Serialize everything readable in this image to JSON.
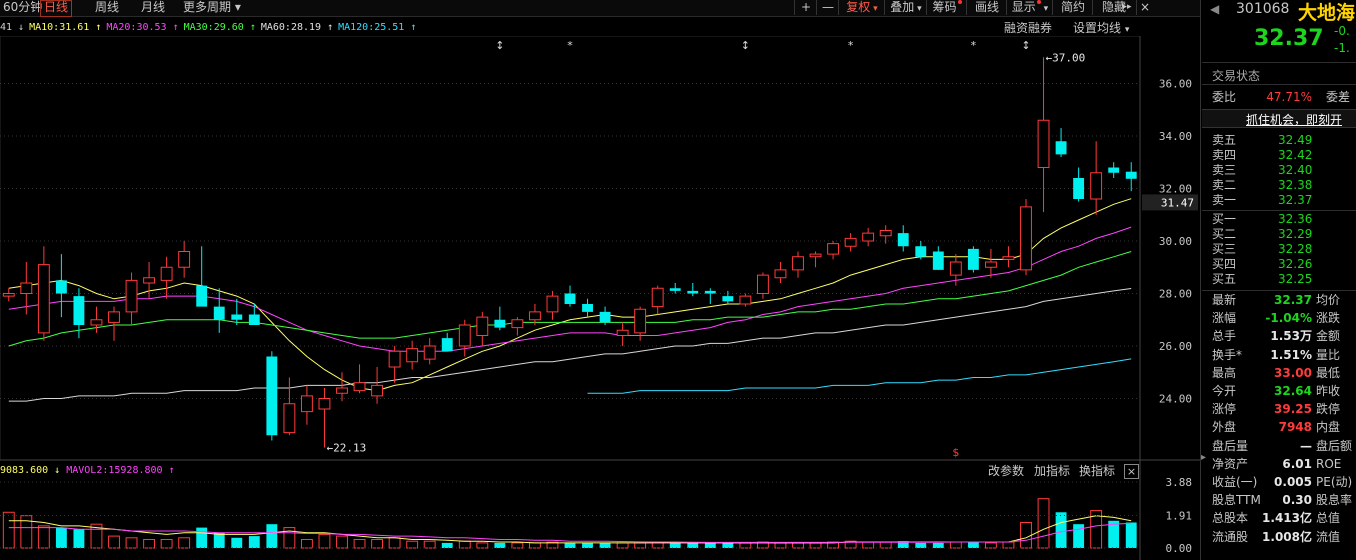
{
  "toolbar": {
    "left_tabs": [
      "60分钟",
      "日线",
      "周线",
      "月线",
      "更多周期"
    ],
    "active_tab": "日线",
    "right_buttons": [
      {
        "label": "+",
        "red": false,
        "dot": false,
        "arrow": false
      },
      {
        "label": "—",
        "red": false,
        "dot": false,
        "arrow": false
      },
      {
        "label": "复权",
        "red": true,
        "dot": false,
        "arrow": true
      },
      {
        "label": "叠加",
        "red": false,
        "dot": false,
        "arrow": true
      },
      {
        "label": "筹码",
        "red": false,
        "dot": true,
        "arrow": false
      },
      {
        "label": "画线",
        "red": false,
        "dot": false,
        "arrow": false
      },
      {
        "label": "显示",
        "red": false,
        "dot": true,
        "arrow": true
      },
      {
        "label": "简约",
        "red": false,
        "dot": false,
        "arrow": false
      },
      {
        "label": "隐藏",
        "red": false,
        "dot": false,
        "arrow": false
      }
    ]
  },
  "ma_legend": [
    {
      "text": "41 ↓",
      "color": "#d0d0d0"
    },
    {
      "text": "MA10:31.61 ↑",
      "color": "#ffff66"
    },
    {
      "text": "MA20:30.53 ↑",
      "color": "#ff44ff"
    },
    {
      "text": "MA30:29.60 ↑",
      "color": "#44ff44"
    },
    {
      "text": "MA60:28.19 ↑",
      "color": "#e0e0e0"
    },
    {
      "text": "MA120:25.51 ↑",
      "color": "#33ddff"
    }
  ],
  "top_right": {
    "financing": "融资融券",
    "ma_settings": "设置均线"
  },
  "annotations": {
    "high": "37.00",
    "low": "22.13",
    "current_price_tag": "31.47"
  },
  "event_markers": [
    "↕",
    "*",
    "↕",
    "*",
    "*",
    "↕"
  ],
  "volume_legend": [
    {
      "text": "9083.600 ↓",
      "color": "#ffff66"
    },
    {
      "text": "MAVOL2:15928.800 ↑",
      "color": "#ff44ff"
    }
  ],
  "volume_tools": {
    "param": "改参数",
    "add": "加指标",
    "swap": "换指标",
    "close": "×"
  },
  "chart_data": {
    "type": "candlestick",
    "price_axis": {
      "min": 22,
      "max": 38,
      "ticks": [
        "36.00",
        "34.00",
        "32.00",
        "30.00",
        "28.00",
        "26.00",
        "24.00"
      ]
    },
    "volume_axis": {
      "ticks": [
        "3.88",
        "1.91",
        "0.00"
      ]
    },
    "candles": [
      [
        27.9,
        28.2,
        27.7,
        28.0
      ],
      [
        28.0,
        29.2,
        27.2,
        28.4
      ],
      [
        26.5,
        29.8,
        26.2,
        29.1
      ],
      [
        28.5,
        29.5,
        27.1,
        28.0
      ],
      [
        27.9,
        28.2,
        26.3,
        26.8
      ],
      [
        26.8,
        27.5,
        26.5,
        27.0
      ],
      [
        26.9,
        27.5,
        26.2,
        27.3
      ],
      [
        27.3,
        28.8,
        26.8,
        28.5
      ],
      [
        28.4,
        29.2,
        27.8,
        28.6
      ],
      [
        28.5,
        29.4,
        27.8,
        29.0
      ],
      [
        29.0,
        30.0,
        28.6,
        29.6
      ],
      [
        28.3,
        29.8,
        27.6,
        27.5
      ],
      [
        27.5,
        28.2,
        26.5,
        27.0
      ],
      [
        27.2,
        27.8,
        26.8,
        27.0
      ],
      [
        27.2,
        27.6,
        26.8,
        26.8
      ],
      [
        25.6,
        25.8,
        22.4,
        22.6
      ],
      [
        22.7,
        24.8,
        22.6,
        23.8
      ],
      [
        23.5,
        24.5,
        23.0,
        24.1
      ],
      [
        23.6,
        24.4,
        22.13,
        24.0
      ],
      [
        24.2,
        25.0,
        23.9,
        24.4
      ],
      [
        24.3,
        25.3,
        24.2,
        24.6
      ],
      [
        24.1,
        25.2,
        23.8,
        24.5
      ],
      [
        25.2,
        26.0,
        24.6,
        25.8
      ],
      [
        25.4,
        26.2,
        25.1,
        25.9
      ],
      [
        25.5,
        26.3,
        25.3,
        26.0
      ],
      [
        26.3,
        26.5,
        25.8,
        25.8
      ],
      [
        26.0,
        27.0,
        25.6,
        26.8
      ],
      [
        26.4,
        27.3,
        26.0,
        27.1
      ],
      [
        27.0,
        27.5,
        26.6,
        26.7
      ],
      [
        26.7,
        27.1,
        26.4,
        27.0
      ],
      [
        27.0,
        27.6,
        26.8,
        27.3
      ],
      [
        27.3,
        28.1,
        27.0,
        27.9
      ],
      [
        28.0,
        28.3,
        27.5,
        27.6
      ],
      [
        27.6,
        27.8,
        27.1,
        27.3
      ],
      [
        27.3,
        27.5,
        26.8,
        26.9
      ],
      [
        26.4,
        26.9,
        26.0,
        26.6
      ],
      [
        26.5,
        27.5,
        26.2,
        27.4
      ],
      [
        27.5,
        28.3,
        27.2,
        28.2
      ],
      [
        28.2,
        28.4,
        28.0,
        28.1
      ],
      [
        28.1,
        28.4,
        27.9,
        28.0
      ],
      [
        28.1,
        28.2,
        27.6,
        28.0
      ],
      [
        27.9,
        28.1,
        27.6,
        27.7
      ],
      [
        27.6,
        28.0,
        27.5,
        27.9
      ],
      [
        28.0,
        28.8,
        27.8,
        28.7
      ],
      [
        28.6,
        29.2,
        28.4,
        28.9
      ],
      [
        28.9,
        29.6,
        28.6,
        29.4
      ],
      [
        29.4,
        29.6,
        29.0,
        29.5
      ],
      [
        29.5,
        30.0,
        29.3,
        29.9
      ],
      [
        29.8,
        30.3,
        29.6,
        30.1
      ],
      [
        30.0,
        30.5,
        29.8,
        30.3
      ],
      [
        30.2,
        30.6,
        29.9,
        30.4
      ],
      [
        30.3,
        30.6,
        29.6,
        29.8
      ],
      [
        29.8,
        30.0,
        29.3,
        29.4
      ],
      [
        29.6,
        29.8,
        28.9,
        28.9
      ],
      [
        28.7,
        29.5,
        28.3,
        29.2
      ],
      [
        29.7,
        29.8,
        28.8,
        28.9
      ],
      [
        29.0,
        29.7,
        28.6,
        29.2
      ],
      [
        29.3,
        29.8,
        29.0,
        29.4
      ],
      [
        28.9,
        31.6,
        28.7,
        31.3
      ],
      [
        32.8,
        37.0,
        31.1,
        34.6
      ],
      [
        33.8,
        34.3,
        33.2,
        33.3
      ],
      [
        32.4,
        32.8,
        31.5,
        31.6
      ],
      [
        31.6,
        33.8,
        31.0,
        32.6
      ],
      [
        32.8,
        33.0,
        32.4,
        32.6
      ],
      [
        32.64,
        33.0,
        31.9,
        32.37
      ]
    ],
    "volumes": [
      2.1,
      1.9,
      1.3,
      1.2,
      1.1,
      1.4,
      0.7,
      0.6,
      0.5,
      0.5,
      0.6,
      1.2,
      0.9,
      0.6,
      0.7,
      1.4,
      1.2,
      0.5,
      0.8,
      0.7,
      0.5,
      0.5,
      0.6,
      0.4,
      0.4,
      0.3,
      0.4,
      0.3,
      0.3,
      0.3,
      0.3,
      0.35,
      0.3,
      0.3,
      0.3,
      0.3,
      0.3,
      0.35,
      0.3,
      0.3,
      0.3,
      0.3,
      0.3,
      0.35,
      0.3,
      0.3,
      0.3,
      0.35,
      0.4,
      0.35,
      0.35,
      0.4,
      0.3,
      0.3,
      0.35,
      0.35,
      0.3,
      0.35,
      1.5,
      2.9,
      2.1,
      1.4,
      2.2,
      1.6,
      1.5
    ],
    "ma_lines": {
      "MA10": [
        28.2,
        28.3,
        28.4,
        28.5,
        28.3,
        28.0,
        27.8,
        27.9,
        28.1,
        28.2,
        28.4,
        28.3,
        28.1,
        27.9,
        27.6,
        26.9,
        26.2,
        25.6,
        25.1,
        24.7,
        24.4,
        24.3,
        24.5,
        24.6,
        24.9,
        25.2,
        25.5,
        25.8,
        26.0,
        26.3,
        26.6,
        26.8,
        27.0,
        27.1,
        27.2,
        27.1,
        27.1,
        27.2,
        27.3,
        27.4,
        27.5,
        27.6,
        27.6,
        27.7,
        27.8,
        28.0,
        28.2,
        28.4,
        28.7,
        28.9,
        29.1,
        29.3,
        29.4,
        29.4,
        29.4,
        29.4,
        29.3,
        29.3,
        29.5,
        30.1,
        30.5,
        30.8,
        31.1,
        31.4,
        31.61
      ],
      "MA20": [
        27.4,
        27.5,
        27.6,
        27.7,
        27.7,
        27.7,
        27.7,
        27.8,
        27.8,
        27.9,
        27.9,
        27.9,
        27.8,
        27.7,
        27.5,
        27.2,
        26.9,
        26.6,
        26.4,
        26.2,
        26.0,
        25.9,
        25.8,
        25.8,
        25.8,
        25.8,
        25.9,
        26.0,
        26.1,
        26.2,
        26.3,
        26.4,
        26.5,
        26.5,
        26.5,
        26.4,
        26.4,
        26.4,
        26.5,
        26.6,
        26.7,
        26.9,
        27.0,
        27.2,
        27.3,
        27.5,
        27.6,
        27.7,
        27.8,
        27.9,
        28.0,
        28.2,
        28.3,
        28.4,
        28.5,
        28.6,
        28.7,
        28.8,
        29.0,
        29.3,
        29.6,
        29.8,
        30.1,
        30.3,
        30.53
      ],
      "MA30": [
        26.0,
        26.2,
        26.3,
        26.5,
        26.6,
        26.7,
        26.8,
        26.8,
        26.9,
        27.0,
        27.0,
        27.0,
        27.0,
        26.9,
        26.9,
        26.8,
        26.7,
        26.6,
        26.5,
        26.4,
        26.3,
        26.3,
        26.3,
        26.4,
        26.5,
        26.6,
        26.7,
        26.8,
        26.8,
        26.9,
        26.9,
        26.9,
        26.9,
        26.9,
        26.9,
        26.9,
        26.9,
        26.9,
        26.9,
        27.0,
        27.0,
        27.1,
        27.1,
        27.1,
        27.2,
        27.3,
        27.3,
        27.4,
        27.4,
        27.5,
        27.6,
        27.6,
        27.7,
        27.8,
        27.8,
        27.9,
        28.0,
        28.1,
        28.3,
        28.5,
        28.7,
        29.0,
        29.2,
        29.4,
        29.6
      ],
      "MA60": [
        23.9,
        23.9,
        24.0,
        24.0,
        24.1,
        24.1,
        24.1,
        24.2,
        24.2,
        24.2,
        24.3,
        24.3,
        24.3,
        24.3,
        24.4,
        24.4,
        24.4,
        24.5,
        24.5,
        24.5,
        24.6,
        24.6,
        24.7,
        24.8,
        24.8,
        24.9,
        25.0,
        25.1,
        25.2,
        25.3,
        25.4,
        25.4,
        25.5,
        25.6,
        25.7,
        25.7,
        25.8,
        25.9,
        26.0,
        26.0,
        26.1,
        26.1,
        26.2,
        26.3,
        26.3,
        26.4,
        26.5,
        26.5,
        26.6,
        26.7,
        26.8,
        26.8,
        26.9,
        27.0,
        27.1,
        27.2,
        27.3,
        27.4,
        27.5,
        27.7,
        27.8,
        27.9,
        28.0,
        28.1,
        28.19
      ],
      "MA120": [
        null,
        null,
        null,
        null,
        null,
        null,
        null,
        null,
        null,
        null,
        null,
        null,
        null,
        null,
        null,
        null,
        null,
        null,
        null,
        null,
        null,
        null,
        null,
        null,
        null,
        null,
        null,
        null,
        null,
        null,
        null,
        null,
        null,
        24.2,
        24.2,
        24.2,
        24.3,
        24.3,
        24.3,
        24.3,
        24.3,
        24.3,
        24.4,
        24.4,
        24.4,
        24.4,
        24.4,
        24.5,
        24.5,
        24.5,
        24.6,
        24.6,
        24.6,
        24.7,
        24.7,
        24.8,
        24.8,
        24.9,
        24.9,
        25.0,
        25.1,
        25.2,
        25.3,
        25.4,
        25.51
      ]
    },
    "vol_ma": [
      1.6,
      1.6,
      1.5,
      1.3,
      1.3,
      1.2,
      1.1,
      1.0,
      0.9,
      0.8,
      0.9,
      0.9,
      0.8,
      0.8,
      0.8,
      0.9,
      1.0,
      0.9,
      0.9,
      0.8,
      0.7,
      0.6,
      0.6,
      0.5,
      0.5,
      0.45,
      0.4,
      0.4,
      0.35,
      0.35,
      0.3,
      0.3,
      0.3,
      0.3,
      0.3,
      0.3,
      0.3,
      0.3,
      0.3,
      0.3,
      0.3,
      0.3,
      0.3,
      0.3,
      0.3,
      0.3,
      0.3,
      0.3,
      0.35,
      0.35,
      0.35,
      0.35,
      0.35,
      0.35,
      0.35,
      0.35,
      0.35,
      0.35,
      0.6,
      1.1,
      1.5,
      1.7,
      1.9,
      1.8,
      1.6
    ],
    "vol_ma2": [
      1.2,
      1.2,
      1.2,
      1.2,
      1.1,
      1.1,
      1.1,
      1.0,
      1.0,
      1.0,
      1.0,
      0.95,
      0.9,
      0.9,
      0.9,
      0.9,
      0.9,
      0.85,
      0.85,
      0.8,
      0.8,
      0.75,
      0.7,
      0.7,
      0.65,
      0.6,
      0.6,
      0.55,
      0.5,
      0.5,
      0.45,
      0.45,
      0.4,
      0.4,
      0.4,
      0.38,
      0.36,
      0.35,
      0.35,
      0.34,
      0.33,
      0.33,
      0.33,
      0.33,
      0.33,
      0.33,
      0.33,
      0.33,
      0.34,
      0.34,
      0.34,
      0.34,
      0.34,
      0.34,
      0.35,
      0.35,
      0.35,
      0.35,
      0.45,
      0.7,
      0.95,
      1.1,
      1.3,
      1.4,
      1.45
    ]
  },
  "right_panel": {
    "code": "301068",
    "name": "大地海",
    "price": "32.37",
    "change": "-0.",
    "change_pct": "-1.",
    "order_status_title": "交易状态",
    "weibi": {
      "label": "委比",
      "value": "47.71%",
      "label2": "委差"
    },
    "banner": "抓住机会，即刻开",
    "asks": [
      {
        "label": "卖五",
        "price": "32.49"
      },
      {
        "label": "卖四",
        "price": "32.42"
      },
      {
        "label": "卖三",
        "price": "32.40"
      },
      {
        "label": "卖二",
        "price": "32.38"
      },
      {
        "label": "卖一",
        "price": "32.37"
      }
    ],
    "bids": [
      {
        "label": "买一",
        "price": "32.36"
      },
      {
        "label": "买二",
        "price": "32.29"
      },
      {
        "label": "买三",
        "price": "32.28"
      },
      {
        "label": "买四",
        "price": "32.26"
      },
      {
        "label": "买五",
        "price": "32.25"
      }
    ],
    "stats": [
      {
        "label": "最新",
        "value": "32.37",
        "color": "green",
        "label2": "均价"
      },
      {
        "label": "涨幅",
        "value": "-1.04%",
        "color": "green",
        "label2": "涨跌"
      },
      {
        "label": "总手",
        "value": "1.53万",
        "color": "white",
        "label2": "金额"
      },
      {
        "label": "换手*",
        "value": "1.51%",
        "color": "white",
        "label2": "量比"
      },
      {
        "label": "最高",
        "value": "33.00",
        "color": "red",
        "label2": "最低"
      },
      {
        "label": "今开",
        "value": "32.64",
        "color": "green",
        "label2": "昨收"
      },
      {
        "label": "涨停",
        "value": "39.25",
        "color": "red",
        "label2": "跌停"
      },
      {
        "label": "外盘",
        "value": "7948",
        "color": "red",
        "label2": "内盘"
      },
      {
        "label": "盘后量",
        "value": "—",
        "color": "white",
        "label2": "盘后额"
      },
      {
        "label": "净资产",
        "value": "6.01",
        "color": "white",
        "label2": "ROE"
      },
      {
        "label": "收益(一)",
        "value": "0.005",
        "color": "white",
        "label2": "PE(动)"
      },
      {
        "label": "股息TTM",
        "value": "0.30",
        "color": "white",
        "label2": "股息率"
      },
      {
        "label": "总股本",
        "value": "1.413亿",
        "color": "white",
        "label2": "总值"
      },
      {
        "label": "流通股",
        "value": "1.008亿",
        "color": "white",
        "label2": "流值"
      }
    ]
  }
}
